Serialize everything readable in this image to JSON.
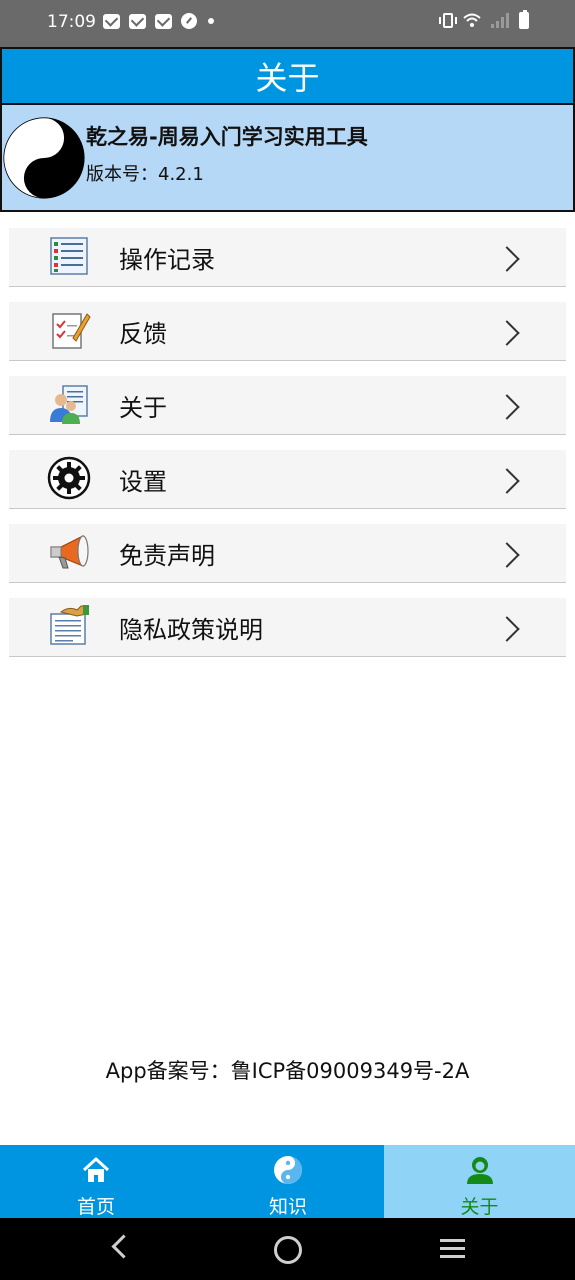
{
  "status_bar": {
    "time": "17:09",
    "left_icons": [
      "mail-icon",
      "mail-icon",
      "mail-icon",
      "gauge-icon",
      "dot-icon"
    ],
    "right_icons": [
      "vibrate-icon",
      "wifi-icon",
      "signal-icon",
      "battery-charging-icon"
    ]
  },
  "header": {
    "title": "关于"
  },
  "app_info": {
    "name": "乾之易-周易入门学习实用工具",
    "version": "版本号：4.2.1",
    "logo": "yin-yang-icon"
  },
  "menu": {
    "items": [
      {
        "label": "操作记录",
        "icon": "list-icon"
      },
      {
        "label": "反馈",
        "icon": "feedback-pen-icon"
      },
      {
        "label": "关于",
        "icon": "about-users-icon"
      },
      {
        "label": "设置",
        "icon": "gear-icon"
      },
      {
        "label": "免责声明",
        "icon": "megaphone-icon"
      },
      {
        "label": "隐私政策说明",
        "icon": "privacy-document-icon"
      }
    ]
  },
  "footer": {
    "icp": "App备案号：鲁ICP备09009349号-2A"
  },
  "bottom_nav": {
    "tabs": [
      {
        "label": "首页",
        "icon": "home-icon",
        "active": false
      },
      {
        "label": "知识",
        "icon": "taiji-icon",
        "active": false
      },
      {
        "label": "关于",
        "icon": "user-icon",
        "active": true
      }
    ]
  },
  "colors": {
    "primary": "#0095e0",
    "app_info_bg": "#b6d8f7",
    "active_tab_bg": "#8fd3f7",
    "active_tab_text": "#138a18"
  }
}
